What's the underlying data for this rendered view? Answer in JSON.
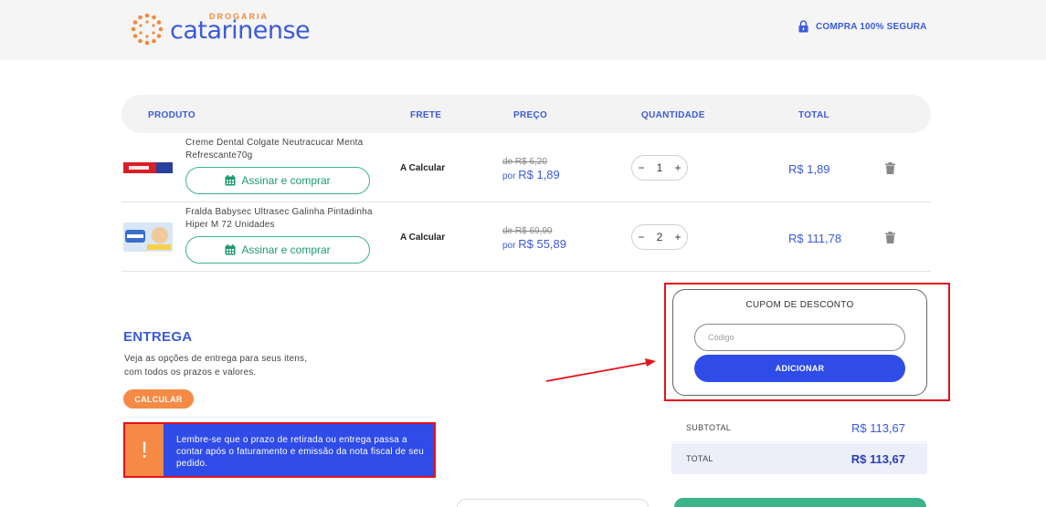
{
  "header": {
    "logo_sub": "DROGARIA",
    "logo_name": "catarinense",
    "secure_text": "COMPRA 100% SEGURA"
  },
  "table": {
    "columns": [
      "PRODUTO",
      "FRETE",
      "PREÇO",
      "QUANTIDADE",
      "TOTAL"
    ]
  },
  "products": [
    {
      "name": "Creme Dental Colgate Neutracucar Menta Refrescante70g",
      "subscribe_label": "Assinar e comprar",
      "frete": "A Calcular",
      "old_price": "de R$ 6,20",
      "price_prefix": "por",
      "price": "R$ 1,89",
      "quantity": "1",
      "total": "R$ 1,89"
    },
    {
      "name": "Fralda Babysec Ultrasec Galinha Pintadinha Hiper M 72 Unidades",
      "subscribe_label": "Assinar e comprar",
      "frete": "A Calcular",
      "old_price": "de R$ 69,90",
      "price_prefix": "por",
      "price": "R$ 55,89",
      "quantity": "2",
      "total": "R$ 111,78"
    }
  ],
  "stepper": {
    "minus": "−",
    "plus": "+"
  },
  "coupon": {
    "title": "CUPOM DE DESCONTO",
    "placeholder": "Código",
    "button": "ADICIONAR"
  },
  "delivery": {
    "title": "ENTREGA",
    "description": "Veja as opções de entrega para seus itens, com todos os prazos e valores.",
    "button": "CALCULAR",
    "notice_icon": "!",
    "notice": "Lembre-se que o prazo de retirada ou entrega passa a contar após o faturamento e emissão da nota fiscal de seu pedido."
  },
  "summary": {
    "subtotal_label": "SUBTOTAL",
    "subtotal_value": "R$ 113,67",
    "total_label": "TOTAL",
    "total_value": "R$ 113,67"
  },
  "colors": {
    "brand_blue": "#3a5bd9",
    "brand_orange": "#f08a3c",
    "highlight_red": "#e3121a",
    "green": "#3bb48a"
  },
  "icons": {
    "secure": "lock-icon",
    "subscribe": "calendar-icon",
    "remove": "trash-icon",
    "notice": "exclamation-icon"
  }
}
